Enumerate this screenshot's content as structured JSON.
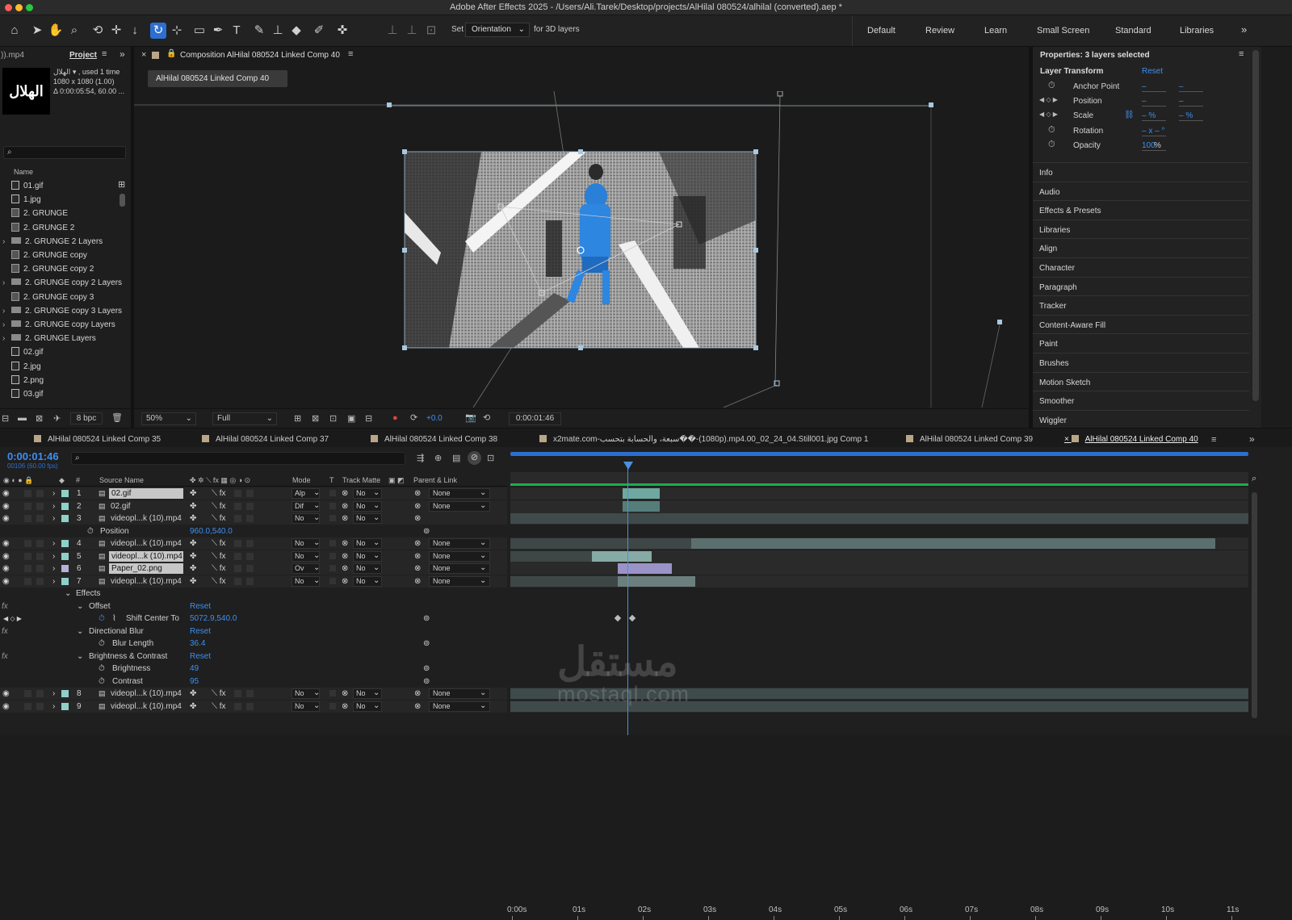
{
  "window": {
    "title": "Adobe After Effects 2025 - /Users/Ali.Tarek/Desktop/projects/AlHilal 080524/alhilal (converted).aep *"
  },
  "toolbar": {
    "set_label": "Set",
    "orientation_value": "Orientation",
    "for3d_label": "for 3D layers",
    "workspaces": [
      "Default",
      "Review",
      "Learn",
      "Small Screen",
      "Standard",
      "Libraries"
    ]
  },
  "project": {
    "left_tab": ")).mp4",
    "tab": "Project",
    "thumb_logo": "الهلال",
    "info_line1": "الهلال ▾ , used 1 time",
    "info_line2": "1080 x 1080 (1.00)",
    "info_line3": "Δ 0:00:05:54, 60.00 ...",
    "name_header": "Name",
    "items": [
      {
        "name": "01.gif",
        "kind": "file"
      },
      {
        "name": "1.jpg",
        "kind": "file"
      },
      {
        "name": "2. GRUNGE",
        "kind": "comp"
      },
      {
        "name": "2. GRUNGE 2",
        "kind": "comp"
      },
      {
        "name": "2. GRUNGE 2 Layers",
        "kind": "folder"
      },
      {
        "name": "2. GRUNGE copy",
        "kind": "comp"
      },
      {
        "name": "2. GRUNGE copy 2",
        "kind": "comp"
      },
      {
        "name": "2. GRUNGE copy 2 Layers",
        "kind": "folder"
      },
      {
        "name": "2. GRUNGE copy 3",
        "kind": "comp"
      },
      {
        "name": "2. GRUNGE copy 3 Layers",
        "kind": "folder"
      },
      {
        "name": "2. GRUNGE copy Layers",
        "kind": "folder"
      },
      {
        "name": "2. GRUNGE Layers",
        "kind": "folder"
      },
      {
        "name": "02.gif",
        "kind": "file"
      },
      {
        "name": "2.jpg",
        "kind": "file"
      },
      {
        "name": "2.png",
        "kind": "file"
      },
      {
        "name": "03.gif",
        "kind": "file"
      }
    ],
    "bpc": "8 bpc"
  },
  "composition": {
    "panel_title": "Composition AlHilal 080524 Linked Comp 40",
    "breadcrumb": "AlHilal 080524 Linked Comp 40",
    "zoom": "50%",
    "resolution": "Full",
    "exposure": "+0.0",
    "timecode": "0:00:01:46"
  },
  "properties": {
    "title": "Properties: 3 layers selected",
    "section": "Layer Transform",
    "reset": "Reset",
    "rows": [
      {
        "label": "Anchor Point",
        "v1": "–",
        "v2": "–"
      },
      {
        "label": "Position",
        "v1": "–",
        "v2": "–"
      },
      {
        "label": "Scale",
        "v1": "– %",
        "v2": "– %"
      },
      {
        "label": "Rotation",
        "v1": "– x – °",
        "v2": ""
      },
      {
        "label": "Opacity",
        "v1": "100",
        "v2": "%"
      }
    ],
    "panels": [
      "Info",
      "Audio",
      "Effects & Presets",
      "Libraries",
      "Align",
      "Character",
      "Paragraph",
      "Tracker",
      "Content-Aware Fill",
      "Paint",
      "Brushes",
      "Motion Sketch",
      "Smoother",
      "Wiggler"
    ]
  },
  "timeline": {
    "tabs": [
      {
        "label": "AlHilal 080524 Linked Comp 35",
        "color": "#b9a688"
      },
      {
        "label": "AlHilal 080524 Linked Comp 37",
        "color": "#b9a688"
      },
      {
        "label": "AlHilal 080524 Linked Comp 38",
        "color": "#b9a688"
      },
      {
        "label": "x2mate.com-سبعة، والحسابة بتحسب��-(1080p).mp4.00_02_24_04.Still001.jpg Comp 1",
        "color": "#b9a688"
      },
      {
        "label": "AlHilal 080524 Linked Comp 39",
        "color": "#b9a688"
      },
      {
        "label": "AlHilal 080524 Linked Comp 40",
        "color": "#b9a688"
      }
    ],
    "current_time": "0:00:01:46",
    "frame_info": "00106 (60.00 fps)",
    "col_source": "Source Name",
    "col_mode": "Mode",
    "col_t": "T",
    "col_trackmatte": "Track Matte",
    "col_parent": "Parent & Link",
    "ruler": [
      "0:00s",
      "01s",
      "02s",
      "03s",
      "04s",
      "05s",
      "06s",
      "07s",
      "08s",
      "09s",
      "10s",
      "11s"
    ],
    "rows": [
      {
        "type": "layer",
        "num": "1",
        "name": "02.gif",
        "mode": "Alp",
        "tm": "No",
        "parent": "None",
        "selected": true,
        "color": "#8fd0c8"
      },
      {
        "type": "layer",
        "num": "2",
        "name": "02.gif",
        "mode": "Dif",
        "tm": "No",
        "parent": "None",
        "selected": false,
        "color": "#8fd0c8"
      },
      {
        "type": "layer",
        "num": "3",
        "name": "videopl...k (10).mp4",
        "mode": "No",
        "tm": "No",
        "parent": "",
        "selected": false,
        "color": "#8fd0c8"
      },
      {
        "type": "prop",
        "name": "Position",
        "value": "960.0,540.0"
      },
      {
        "type": "layer",
        "num": "4",
        "name": "videopl...k (10).mp4",
        "mode": "No",
        "tm": "No",
        "parent": "None",
        "selected": false,
        "color": "#8fd0c8"
      },
      {
        "type": "layer",
        "num": "5",
        "name": "videopl...k (10).mp4",
        "mode": "No",
        "tm": "No",
        "parent": "None",
        "selected": true,
        "color": "#8fd0c8"
      },
      {
        "type": "layer",
        "num": "6",
        "name": "Paper_02.png",
        "mode": "Ov",
        "tm": "No",
        "parent": "None",
        "selected": true,
        "color": "#b5b0d8"
      },
      {
        "type": "layer",
        "num": "7",
        "name": "videopl...k (10).mp4",
        "mode": "No",
        "tm": "No",
        "parent": "None",
        "selected": false,
        "color": "#8fd0c8"
      },
      {
        "type": "group",
        "name": "Effects"
      },
      {
        "type": "effect",
        "name": "Offset",
        "reset": "Reset"
      },
      {
        "type": "prop",
        "name": "Shift Center To",
        "value": "5072.9,540.0"
      },
      {
        "type": "effect",
        "name": "Directional Blur",
        "reset": "Reset"
      },
      {
        "type": "prop",
        "name": "Blur Length",
        "value": "36.4"
      },
      {
        "type": "effect",
        "name": "Brightness & Contrast",
        "reset": "Reset"
      },
      {
        "type": "prop",
        "name": "Brightness",
        "value": "49"
      },
      {
        "type": "prop",
        "name": "Contrast",
        "value": "95"
      },
      {
        "type": "layer",
        "num": "8",
        "name": "videopl...k (10).mp4",
        "mode": "No",
        "tm": "No",
        "parent": "None",
        "selected": false,
        "color": "#8fd0c8"
      },
      {
        "type": "layer",
        "num": "9",
        "name": "videopl...k (10).mp4",
        "mode": "No",
        "tm": "No",
        "parent": "None",
        "selected": false,
        "color": "#8fd0c8"
      }
    ]
  },
  "watermark": {
    "arabic": "مستقل",
    "latin": "mostaql.com"
  }
}
